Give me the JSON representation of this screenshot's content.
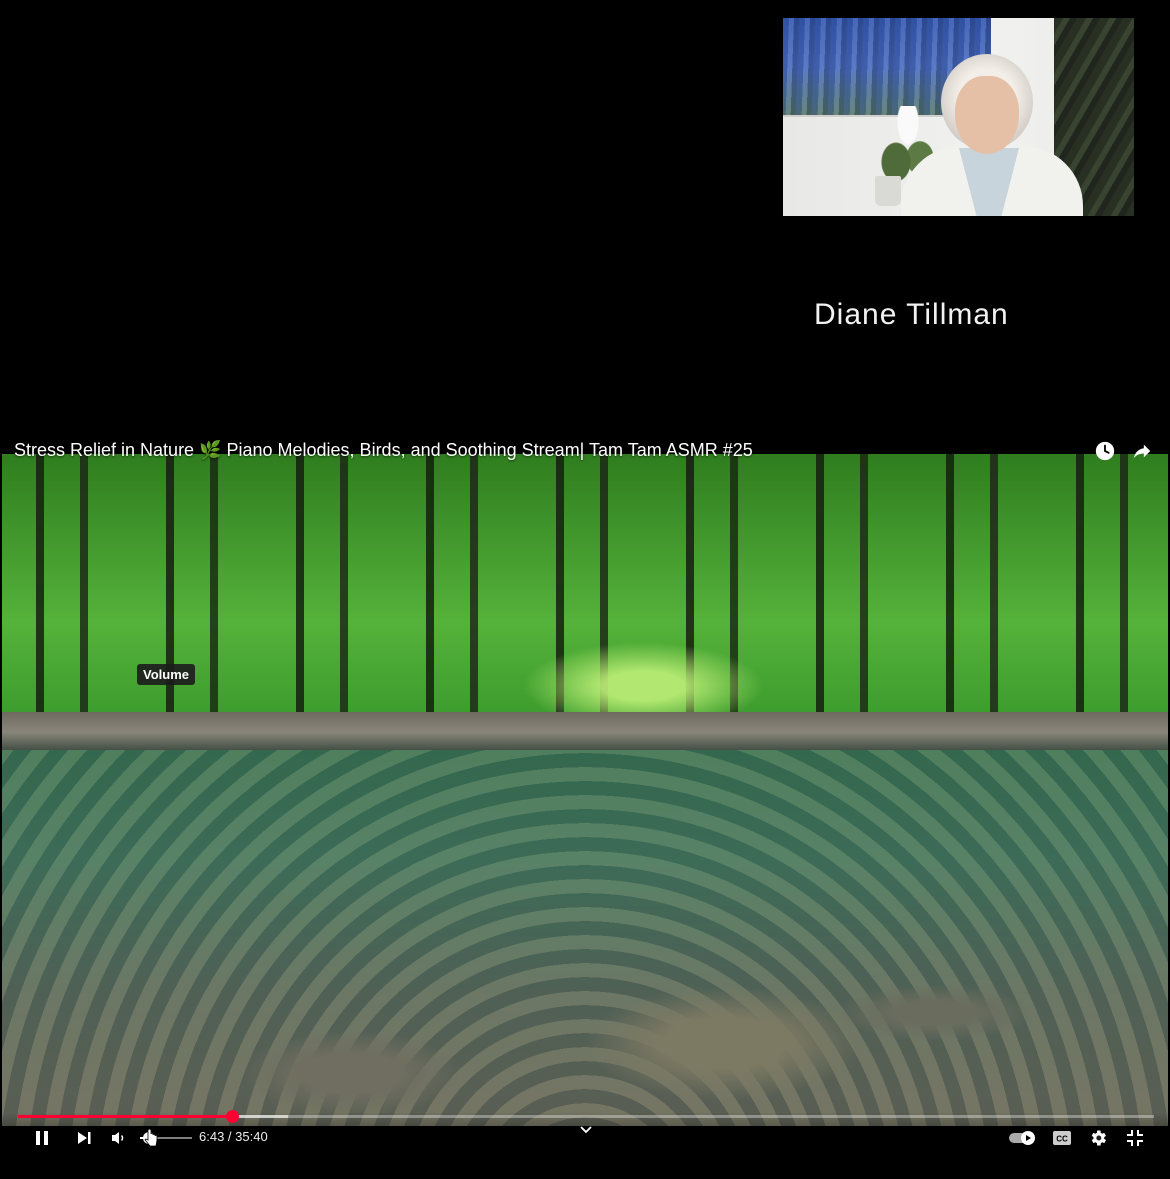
{
  "participant": {
    "name": "Diane Tillman"
  },
  "video": {
    "title": "Stress Relief in Nature 🌿  Piano Melodies, Birds, and Soothing Stream| Tam Tam ASMR #25",
    "current_time": "6:43",
    "duration": "35:40",
    "time_display": "6:43 / 35:40",
    "progress_fraction": 0.188,
    "buffered_fraction": 0.238,
    "volume_fraction": 0.18,
    "tooltip": "Volume",
    "autoplay": "on",
    "state": "playing"
  },
  "icons": {
    "top_right": [
      "watch-later-icon",
      "share-icon"
    ],
    "controls_left": [
      "pause-icon",
      "next-icon",
      "volume-icon"
    ],
    "controls_center": [
      "chevron-down-icon"
    ],
    "controls_right": [
      "autoplay-toggle-icon",
      "captions-icon",
      "settings-icon",
      "fullscreen-exit-icon"
    ]
  },
  "colors": {
    "progress_played": "#ff0033",
    "background": "#000000"
  }
}
